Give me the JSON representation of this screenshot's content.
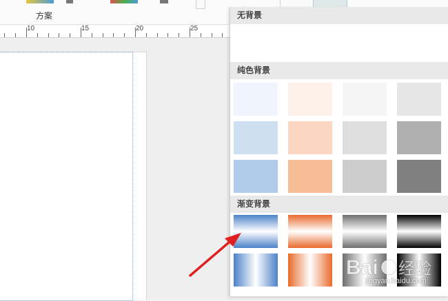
{
  "ribbon": {
    "scheme_label": "方案"
  },
  "ruler": {
    "labels": [
      "10",
      "15",
      "20",
      "25"
    ]
  },
  "panel": {
    "no_background": {
      "header": "无背景"
    },
    "solid": {
      "header": "纯色背景",
      "colors": [
        [
          "#eff3fb",
          "#fdf0e8",
          "#f5f5f5",
          "#e6e6e6"
        ],
        [
          "#cddff1",
          "#fbd6c0",
          "#dedede",
          "#b0b0b0"
        ],
        [
          "#aecbe9",
          "#f6bd97",
          "#cccccc",
          "#808080"
        ]
      ]
    },
    "gradient": {
      "header": "渐变背景",
      "rows": [
        [
          {
            "name": "blue-vertical",
            "stops": [
              "#4b82c8",
              "#ffffff",
              "#4b82c8"
            ]
          },
          {
            "name": "orange-vertical",
            "stops": [
              "#e86b2e",
              "#ffffff",
              "#e86b2e"
            ]
          },
          {
            "name": "gray-vertical",
            "stops": [
              "#6e6e6e",
              "#ffffff",
              "#6e6e6e"
            ]
          },
          {
            "name": "black-vertical",
            "stops": [
              "#000000",
              "#ffffff",
              "#000000"
            ]
          }
        ],
        [
          {
            "name": "blue-horizontal",
            "stops": [
              "#4b82c8",
              "#ffffff",
              "#4b82c8"
            ]
          },
          {
            "name": "orange-horizontal",
            "stops": [
              "#e86b2e",
              "#ffffff",
              "#e86b2e"
            ]
          },
          {
            "name": "gray-horizontal",
            "stops": [
              "#6e6e6e",
              "#ffffff",
              "#6e6e6e"
            ]
          },
          {
            "name": "black-horizontal",
            "stops": [
              "#000000",
              "#ffffff",
              "#000000"
            ]
          }
        ]
      ]
    }
  },
  "annotation": {
    "arrow_color": "#e02020"
  },
  "watermark": {
    "brand": "Baidu经验",
    "url": "jingyan.baidu.com"
  }
}
